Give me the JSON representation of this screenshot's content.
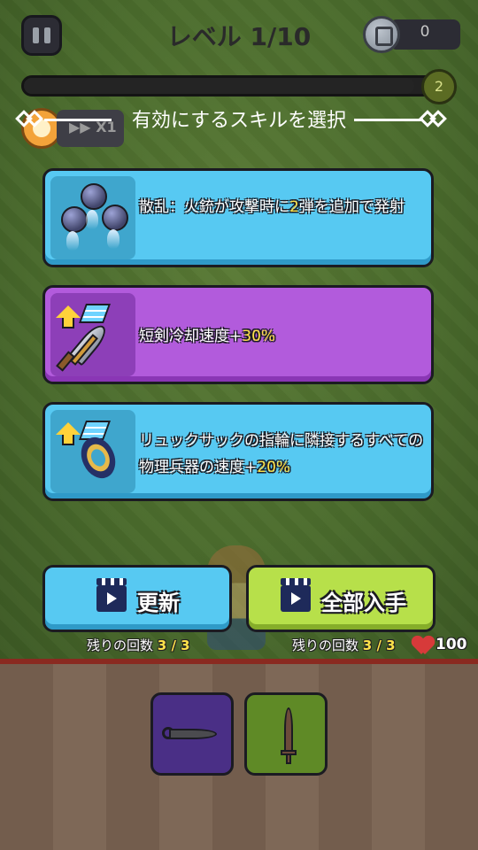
{
  "hud": {
    "level_title": "レベル 1/10",
    "coins": "0",
    "xp_level": "2",
    "xp_progress": 0.95,
    "speed_label": "X1"
  },
  "selection": {
    "title": "有効にするスキルを選択"
  },
  "skills": [
    {
      "icon": "scatter-orbs-icon",
      "text_before": "散乱：火銃が攻撃時に",
      "highlight": "2",
      "text_after": "弾を追加で発射",
      "card_color": "#57c9f2"
    },
    {
      "icon": "dagger-upgrade-icon",
      "text_before": "短剣冷却速度+",
      "highlight": "30%",
      "text_after": "",
      "card_color": "#b25bdc"
    },
    {
      "icon": "backpack-ring-upgrade-icon",
      "text_before": "リュックサックの指輪に隣接するすべての物理兵器の速度+",
      "highlight": "20%",
      "text_after": "",
      "card_color": "#57c9f2"
    }
  ],
  "actions": {
    "refresh_label": "更新",
    "refresh_remaining_label": "残りの回数",
    "refresh_remaining": "3 / 3",
    "getall_label": "全部入手",
    "getall_remaining_label": "残りの回数",
    "getall_remaining": "3 / 3"
  },
  "player": {
    "hp": "100"
  },
  "weapon_slots": [
    {
      "icon": "kunai-icon",
      "color": "#4a2f86"
    },
    {
      "icon": "sword-icon",
      "color": "#5f8a26"
    }
  ]
}
